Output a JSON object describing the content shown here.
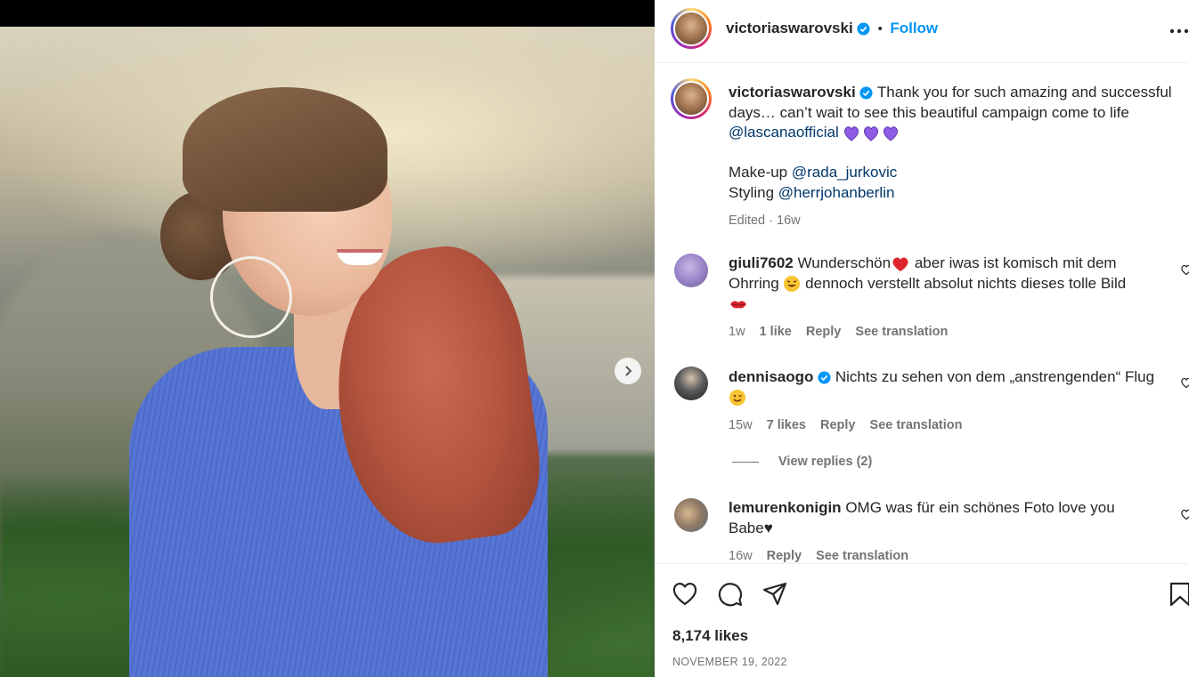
{
  "post": {
    "username": "victoriaswarovski",
    "follow_label": "Follow",
    "separator": "•",
    "more_label": "•••"
  },
  "caption": {
    "username": "victoriaswarovski",
    "text1": "Thank you for such amazing and successful days… can’t wait to see this beautiful campaign come to life",
    "mention1": "@lascanaofficial",
    "makeup_label": "Make-up",
    "mention2": "@rada_jurkovic",
    "styling_label": "Styling",
    "mention3": "@herrjohanberlin",
    "edited": "Edited · 16w"
  },
  "comments": [
    {
      "username": "giuli7602",
      "text_a": "Wunderschön",
      "text_b": "aber iwas ist komisch mit dem Ohrring",
      "text_c": "dennoch verstellt absolut nichts dieses tolle Bild",
      "time": "1w",
      "likes": "1 like",
      "reply": "Reply",
      "translate": "See translation"
    },
    {
      "username": "dennisaogo",
      "text": "Nichts zu sehen von dem „anstrengenden“ Flug",
      "time": "15w",
      "likes": "7 likes",
      "reply": "Reply",
      "translate": "See translation",
      "view_replies": "View replies (2)"
    },
    {
      "username": "lemurenkonigin",
      "text": "OMG was für ein schönes Foto love you Babe♥",
      "time": "16w",
      "reply": "Reply",
      "translate": "See translation"
    }
  ],
  "footer": {
    "likes": "8,174 likes",
    "date": "NOVEMBER 19, 2022"
  },
  "colors": {
    "follow": "#0095f6",
    "link": "#00376b",
    "muted": "#737373",
    "verified": "#0095f6"
  }
}
